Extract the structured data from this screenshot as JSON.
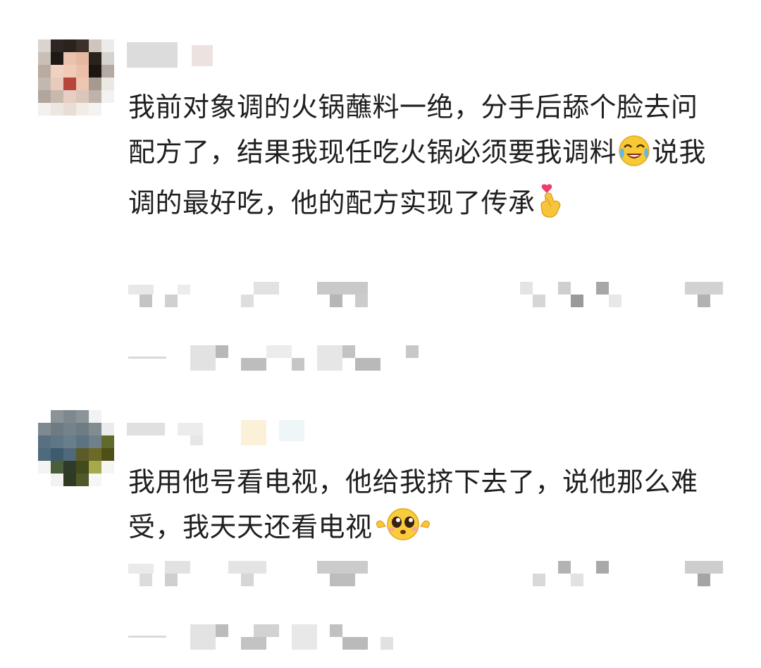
{
  "comments": [
    {
      "text_before_emoji": "我前对象调的火锅蘸料一绝，分手后舔个脸去问配方了，结果我现任吃火锅必须要我调料",
      "emoji_1": "crying-laughing-emoji",
      "text_after_emoji": "说我调的最好吃，他的配方实现了传承",
      "emoji_2": "finger-heart-emoji"
    },
    {
      "text": "我用他号看电视，他给我挤下去了，说他那么难受，我天天还看电视",
      "emoji": "pleading-face-emoji"
    }
  ],
  "colors": {
    "text": "#1f1f1f",
    "blur_light": "#e6e6e6",
    "blur_mid": "#c9c9c9",
    "blur_dark": "#9a9a9a"
  }
}
